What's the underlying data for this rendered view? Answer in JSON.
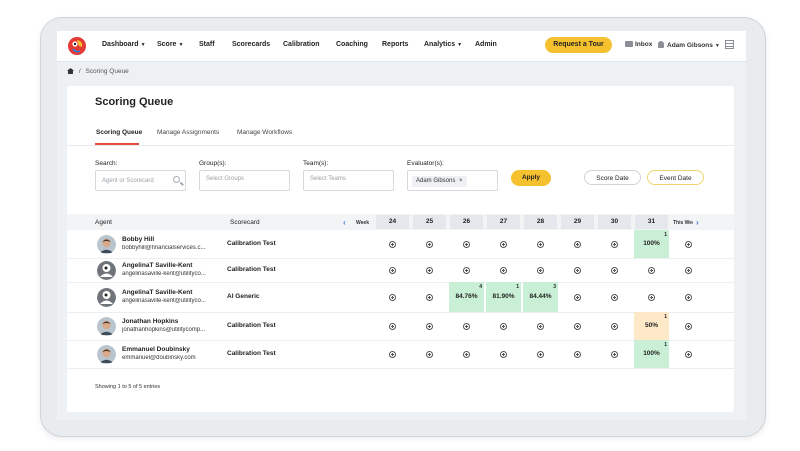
{
  "nav": {
    "items": [
      {
        "label": "Dashboard",
        "dropdown": true
      },
      {
        "label": "Score",
        "dropdown": true
      },
      {
        "label": "Staff",
        "dropdown": false
      },
      {
        "label": "Scorecards",
        "dropdown": false
      },
      {
        "label": "Calibration",
        "dropdown": false
      },
      {
        "label": "Coaching",
        "dropdown": false
      },
      {
        "label": "Reports",
        "dropdown": false
      },
      {
        "label": "Analytics",
        "dropdown": true
      },
      {
        "label": "Admin",
        "dropdown": false
      }
    ],
    "tour_button": "Request a Tour",
    "inbox": "Inbox",
    "user": "Adam Gibsons",
    "caret": "▼"
  },
  "breadcrumb": {
    "separator": "/",
    "current": "Scoring Queue"
  },
  "page": {
    "title": "Scoring Queue"
  },
  "tabs": [
    {
      "label": "Scoring Queue",
      "active": true
    },
    {
      "label": "Manage Assignments",
      "active": false
    },
    {
      "label": "Manage Workflows",
      "active": false
    }
  ],
  "filters": {
    "search_label": "Search:",
    "search_placeholder": "Agent or Scorecard",
    "groups_label": "Group(s):",
    "groups_placeholder": "Select Groups",
    "teams_label": "Team(s):",
    "teams_placeholder": "Select Teams",
    "evaluator_label": "Evaluator(s):",
    "evaluator_chip": "Adam Gibsons",
    "chip_remove": "×",
    "apply": "Apply",
    "score_date": "Score Date",
    "event_date": "Event Date"
  },
  "table": {
    "agent_header": "Agent",
    "scorecard_header": "Scorecard",
    "week_label": "Week",
    "prev_arrow": "‹",
    "next_arrow": "›",
    "days": [
      "24",
      "25",
      "26",
      "27",
      "28",
      "29",
      "30",
      "31"
    ],
    "this_week_label": "This Week",
    "rows": [
      {
        "name": "Bobby Hill",
        "email": "bobbyhill@financialservices.c...",
        "scorecard": "Calibration Test",
        "avatar": "photo",
        "cells": [
          null,
          null,
          null,
          null,
          null,
          null,
          null,
          {
            "score": "100%",
            "count": "1",
            "color": "#c9f0d6"
          },
          null
        ]
      },
      {
        "name": "AngelinaT Saville-Kent",
        "email": "angelinasaville-kent@utilityco...",
        "scorecard": "Calibration Test",
        "avatar": "default",
        "cells": [
          null,
          null,
          null,
          null,
          null,
          null,
          null,
          null,
          null
        ]
      },
      {
        "name": "AngelinaT Saville-Kent",
        "email": "angelinasaville-kent@utilityco...",
        "scorecard": "AI Generic",
        "avatar": "default",
        "cells": [
          null,
          null,
          {
            "score": "84.76%",
            "count": "4",
            "color": "#c9f0d6"
          },
          {
            "score": "81.90%",
            "count": "1",
            "color": "#c9f0d6"
          },
          {
            "score": "84.44%",
            "count": "3",
            "color": "#c9f0d6"
          },
          null,
          null,
          null,
          null
        ]
      },
      {
        "name": "Jonathan Hopkins",
        "email": "jonathanhopkins@utilitycomp...",
        "scorecard": "Calibration Test",
        "avatar": "photo",
        "cells": [
          null,
          null,
          null,
          null,
          null,
          null,
          null,
          {
            "score": "50%",
            "count": "1",
            "color": "#fde9c8"
          },
          null
        ]
      },
      {
        "name": "Emmanuel Doubinsky",
        "email": "emmanuel@doubinsky.com",
        "scorecard": "Calibration Test",
        "avatar": "photo",
        "cells": [
          null,
          null,
          null,
          null,
          null,
          null,
          null,
          {
            "score": "100%",
            "count": "1",
            "color": "#c9f0d6"
          },
          null
        ]
      }
    ],
    "footer": "Showing 1 to 5 of 5 entries"
  }
}
